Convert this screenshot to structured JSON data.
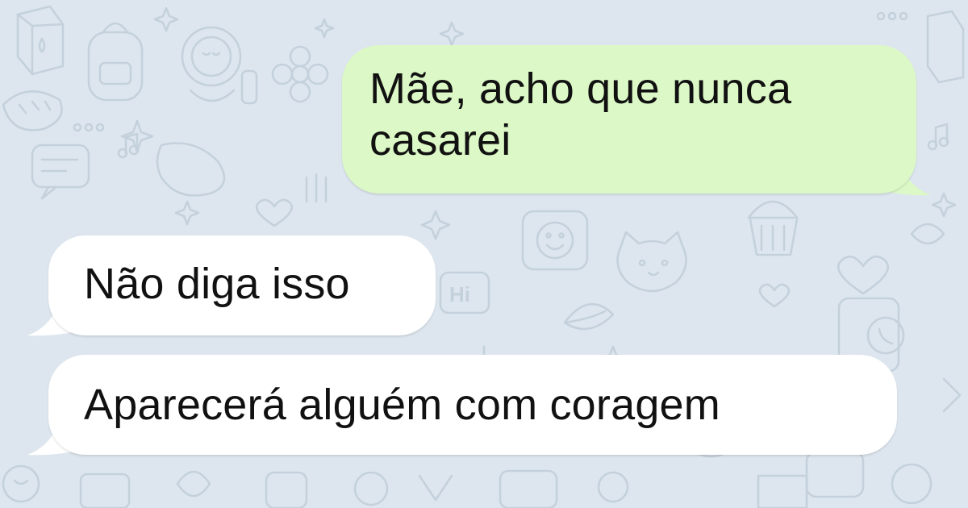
{
  "chat": {
    "background_color": "#dde6ee",
    "messages": [
      {
        "direction": "outgoing",
        "text_line_1": "Mãe, acho que nunca",
        "text_line_2": "casarei",
        "bubble_color": "#dcf8c6"
      },
      {
        "direction": "incoming",
        "text": "Não diga isso",
        "bubble_color": "#ffffff"
      },
      {
        "direction": "incoming",
        "text": "Aparecerá alguém com coragem",
        "bubble_color": "#ffffff"
      }
    ]
  },
  "wallpaper": {
    "doodle_text": "Hi",
    "doodle_icons": [
      "milk-carton-icon",
      "backpack-icon",
      "astronaut-icon",
      "flower-icon",
      "heart-icon",
      "star-icon",
      "music-note-icon",
      "chat-bubble-icon",
      "cat-icon",
      "cupcake-icon",
      "phone-icon",
      "sun-icon",
      "smiley-icon",
      "leaf-icon",
      "bread-icon"
    ]
  }
}
